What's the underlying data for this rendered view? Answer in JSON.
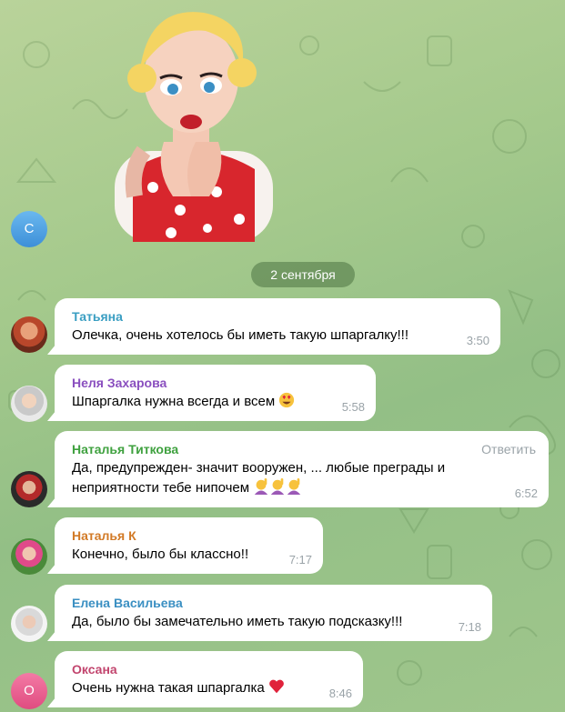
{
  "date_separator": "2 сентября",
  "sender_avatar_top": {
    "letter": "С",
    "color": "#4fa3e0"
  },
  "messages": [
    {
      "name": "Татьяна",
      "name_color": "#3a9ec2",
      "text": "Олечка, очень хотелось бы иметь такую шпаргалку!!!",
      "time": "3:50",
      "avatar": "photo"
    },
    {
      "name": "Неля Захарова",
      "name_color": "#8a4fbf",
      "text": "Шпаргалка нужна всегда и всем",
      "emoji": "heart-eyes-emoji",
      "time": "5:58",
      "avatar": "photo"
    },
    {
      "name": "Наталья Титкова",
      "name_color": "#3fa13f",
      "reply_label": "Ответить",
      "text": "Да, предупрежден- значит вооружен, ... любые преграды и неприятности тебе нипочем",
      "emoji": "raising-hand-emoji x3",
      "time": "6:52",
      "avatar": "photo"
    },
    {
      "name": "Наталья К",
      "name_color": "#d27a26",
      "text": "Конечно, было бы классно!!",
      "time": "7:17",
      "avatar": "photo"
    },
    {
      "name": "Елена Васильева",
      "name_color": "#3a8fc2",
      "text": "Да, было бы замечательно иметь такую подсказку!!!",
      "time": "7:18",
      "avatar": "photo"
    },
    {
      "name": "Оксана",
      "name_color": "#c2456e",
      "text": "Очень нужна такая шпаргалка",
      "emoji": "red-heart-emoji",
      "time": "8:46",
      "avatar_letter": "О",
      "avatar_color": "#e8568a"
    }
  ]
}
